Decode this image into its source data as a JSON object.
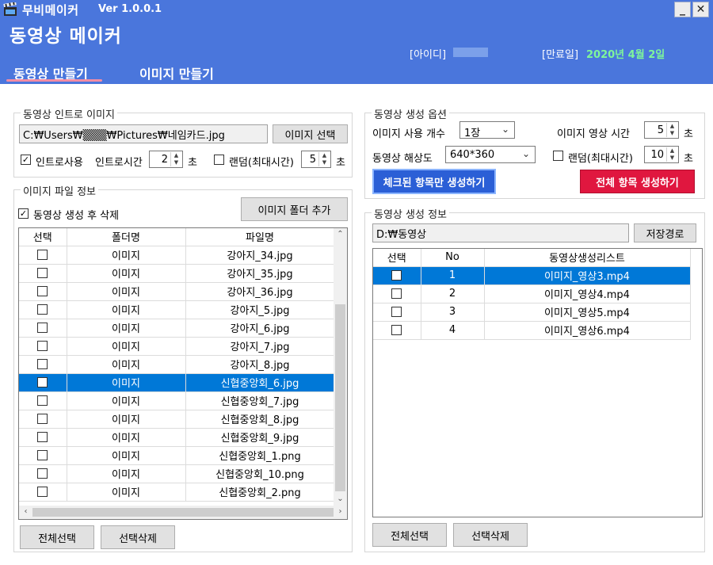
{
  "app": {
    "name": "무비메이커",
    "version": "Ver 1.0.0.1",
    "title": "동영상 메이커",
    "minimize": "_",
    "close": "✕"
  },
  "account": {
    "id_label": "[아이디]",
    "expiry_label": "[만료일]",
    "expiry_value": "2020년 4월 2일"
  },
  "tabs": [
    {
      "label": "동영상 만들기",
      "active": true
    },
    {
      "label": "이미지 만들기",
      "active": false
    }
  ],
  "intro": {
    "legend": "동영상 인트로 이미지",
    "path": "C:₩Users₩▒▒▒₩Pictures₩네임카드.jpg",
    "select_button": "이미지 선택",
    "use_intro_label": "인트로사용",
    "use_intro_checked": true,
    "intro_time_label": "인트로시간",
    "intro_time_value": "2",
    "unit_sec": "초",
    "random_label": "랜덤(최대시간)",
    "random_checked": false,
    "random_value": "5"
  },
  "image_files": {
    "legend": "이미지 파일 정보",
    "delete_after_label": "동영상 생성 후 삭제",
    "delete_after_checked": true,
    "add_folder_button": "이미지 폴더 추가",
    "columns": [
      "선택",
      "폴더명",
      "파일명"
    ],
    "rows": [
      {
        "folder": "이미지",
        "file": "강아지_34.jpg",
        "selected": false
      },
      {
        "folder": "이미지",
        "file": "강아지_35.jpg",
        "selected": false
      },
      {
        "folder": "이미지",
        "file": "강아지_36.jpg",
        "selected": false
      },
      {
        "folder": "이미지",
        "file": "강아지_5.jpg",
        "selected": false
      },
      {
        "folder": "이미지",
        "file": "강아지_6.jpg",
        "selected": false
      },
      {
        "folder": "이미지",
        "file": "강아지_7.jpg",
        "selected": false
      },
      {
        "folder": "이미지",
        "file": "강아지_8.jpg",
        "selected": false
      },
      {
        "folder": "이미지",
        "file": "신협중앙회_6.jpg",
        "selected": true
      },
      {
        "folder": "이미지",
        "file": "신협중앙회_7.jpg",
        "selected": false
      },
      {
        "folder": "이미지",
        "file": "신협중앙회_8.jpg",
        "selected": false
      },
      {
        "folder": "이미지",
        "file": "신협중앙회_9.jpg",
        "selected": false
      },
      {
        "folder": "이미지",
        "file": "신협중앙회_1.png",
        "selected": false
      },
      {
        "folder": "이미지",
        "file": "신협중앙회_10.png",
        "selected": false
      },
      {
        "folder": "이미지",
        "file": "신협중앙회_2.png",
        "selected": false
      }
    ],
    "select_all_button": "전체선택",
    "delete_selected_button": "선택삭제"
  },
  "options": {
    "legend": "동영상 생성 옵션",
    "image_count_label": "이미지 사용 개수",
    "image_count_value": "1장",
    "image_time_label": "이미지 영상 시간",
    "image_time_value": "5",
    "resolution_label": "동영상 해상도",
    "resolution_value": "640*360",
    "random_label": "랜덤(최대시간)",
    "random_checked": false,
    "random_value": "10",
    "unit_sec": "초",
    "create_checked_button": "체크된 항목만 생성하기",
    "create_all_button": "전체 항목 생성하기",
    "accent_blue": "#2b5fd6",
    "accent_red": "#e0173f"
  },
  "video_info": {
    "legend": "동영상 생성 정보",
    "path": "D:₩동영상",
    "save_path_button": "저장경로",
    "columns": [
      "선택",
      "No",
      "동영상생성리스트"
    ],
    "rows": [
      {
        "no": "1",
        "name": "이미지_영상3.mp4",
        "selected": true
      },
      {
        "no": "2",
        "name": "이미지_영상4.mp4",
        "selected": false
      },
      {
        "no": "3",
        "name": "이미지_영상5.mp4",
        "selected": false
      },
      {
        "no": "4",
        "name": "이미지_영상6.mp4",
        "selected": false
      }
    ],
    "select_all_button": "전체선택",
    "delete_selected_button": "선택삭제"
  }
}
